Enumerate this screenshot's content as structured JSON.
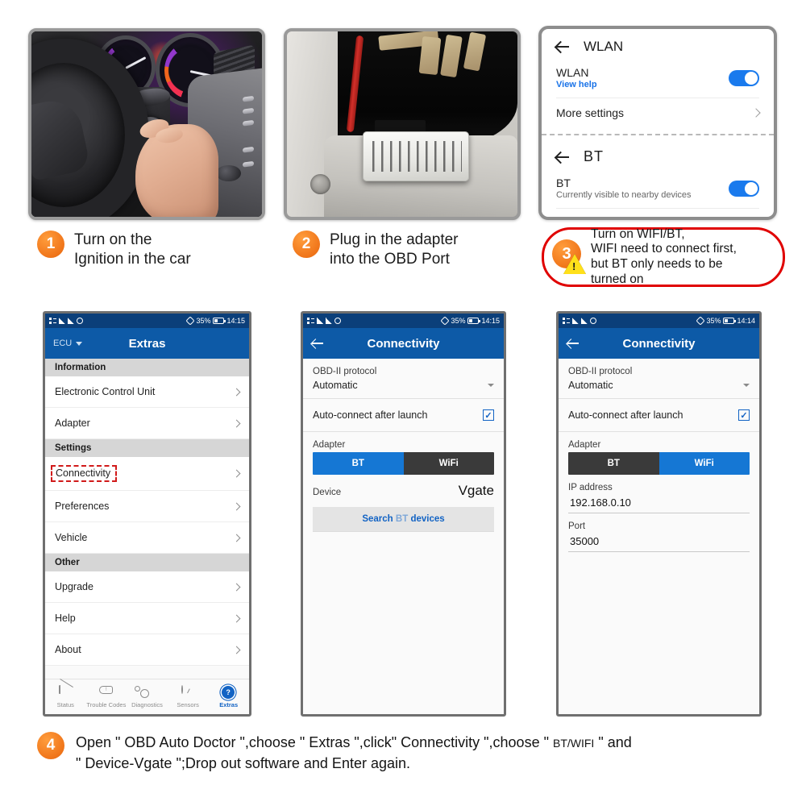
{
  "steps": [
    {
      "number": "1",
      "lines": [
        "Turn on the",
        "Ignition in the car"
      ],
      "photo": "car-ignition-photo"
    },
    {
      "number": "2",
      "lines": [
        "Plug in the adapter",
        "into the OBD Port"
      ],
      "photo": "obd-port-photo"
    },
    {
      "number": "3",
      "lines": [
        "Turn on WIFI/BT,",
        "WIFI need to connect first,",
        "but BT only needs to be",
        "turned on"
      ]
    }
  ],
  "settings_panel": {
    "wlan": {
      "header_title": "WLAN",
      "row_title": "WLAN",
      "row_sub": "View help",
      "toggle_on": true,
      "more_settings": "More settings"
    },
    "bt": {
      "header_title": "BT",
      "row_title": "BT",
      "row_sub": "Currently visible to nearby devices",
      "toggle_on": true
    }
  },
  "phone_extras": {
    "statusbar": {
      "battery": "35%",
      "time": "14:15"
    },
    "appbar": {
      "left_label": "ECU",
      "title": "Extras"
    },
    "sections": [
      {
        "header": "Information",
        "items": [
          {
            "label": "Electronic Control Unit",
            "highlighted": false
          },
          {
            "label": "Adapter",
            "highlighted": false
          }
        ]
      },
      {
        "header": "Settings",
        "items": [
          {
            "label": "Connectivity",
            "highlighted": true
          },
          {
            "label": "Preferences",
            "highlighted": false
          },
          {
            "label": "Vehicle",
            "highlighted": false
          }
        ]
      },
      {
        "header": "Other",
        "items": [
          {
            "label": "Upgrade",
            "highlighted": false
          },
          {
            "label": "Help",
            "highlighted": false
          },
          {
            "label": "About",
            "highlighted": false
          }
        ]
      }
    ],
    "bottom_nav": [
      {
        "label": "Status",
        "icon": "engine-check-icon",
        "active": false
      },
      {
        "label": "Trouble Codes",
        "icon": "engine-codes-icon",
        "active": false
      },
      {
        "label": "Diagnostics",
        "icon": "gears-icon",
        "active": false
      },
      {
        "label": "Sensors",
        "icon": "gauge-icon",
        "active": false
      },
      {
        "label": "Extras",
        "icon": "extras-badge-icon",
        "active": true
      }
    ]
  },
  "phone_bt": {
    "statusbar": {
      "battery": "35%",
      "time": "14:15"
    },
    "appbar": {
      "title": "Connectivity"
    },
    "protocol_label": "OBD-II protocol",
    "protocol_value": "Automatic",
    "autoconnect_label": "Auto-connect after launch",
    "autoconnect_checked": true,
    "adapter_label": "Adapter",
    "segments": [
      {
        "label": "BT",
        "selected": true
      },
      {
        "label": "WiFi",
        "selected": false
      }
    ],
    "device_label": "Device",
    "device_value": "Vgate",
    "search_button": {
      "prefix": "Search",
      "mid": "BT",
      "suffix": "devices"
    }
  },
  "phone_wifi": {
    "statusbar": {
      "battery": "35%",
      "time": "14:14"
    },
    "appbar": {
      "title": "Connectivity"
    },
    "protocol_label": "OBD-II protocol",
    "protocol_value": "Automatic",
    "autoconnect_label": "Auto-connect after launch",
    "autoconnect_checked": true,
    "adapter_label": "Adapter",
    "segments": [
      {
        "label": "BT",
        "selected": false
      },
      {
        "label": "WiFi",
        "selected": true
      }
    ],
    "ip_label": "IP address",
    "ip_value": "192.168.0.10",
    "port_label": "Port",
    "port_value": "35000"
  },
  "final_step": {
    "number": "4",
    "line1_a": "Open \" OBD Auto Doctor \",choose \" Extras \",click\" Connectivity \",choose \" ",
    "line1_small": "BT/WIFI",
    "line1_b": " \" and",
    "line2": "\" Device-Vgate \";Drop out software and Enter again."
  },
  "colors": {
    "accent_orange": "#f0751a",
    "app_blue": "#0d5aa7",
    "statusbar_blue": "#0b3f7a",
    "toggle_blue": "#1a7aed",
    "callout_red": "#e00000",
    "highlight_red": "#d11a1a",
    "segment_blue": "#1577d4",
    "segment_dark": "#3a3a3a",
    "warn_yellow": "#ffe01a"
  }
}
